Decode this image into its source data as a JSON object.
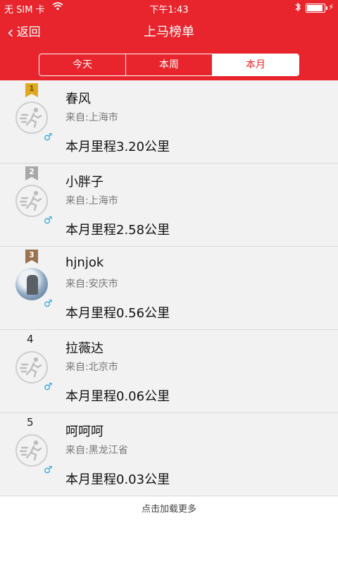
{
  "status": {
    "carrier": "无 SIM 卡",
    "time": "下午1:43"
  },
  "nav": {
    "back_label": "返回",
    "title": "上马榜单"
  },
  "tabs": [
    {
      "label": "今天",
      "active": false
    },
    {
      "label": "本周",
      "active": false
    },
    {
      "label": "本月",
      "active": true
    }
  ],
  "rankings": [
    {
      "rank": "1",
      "name": "春风",
      "location": "来自:上海市",
      "distance": "本月里程3.20公里",
      "gender": "♂"
    },
    {
      "rank": "2",
      "name": "小胖子",
      "location": "来自:上海市",
      "distance": "本月里程2.58公里",
      "gender": "♂"
    },
    {
      "rank": "3",
      "name": "hjnjok",
      "location": "来自:安庆市",
      "distance": "本月里程0.56公里",
      "gender": "♂"
    },
    {
      "rank": "4",
      "name": "拉薇达",
      "location": "来自:北京市",
      "distance": "本月里程0.06公里",
      "gender": "♂"
    },
    {
      "rank": "5",
      "name": " 呵呵呵",
      "location": "来自:黑龙江省",
      "distance": "本月里程0.03公里",
      "gender": "♂"
    }
  ],
  "load_more": "点击加载更多"
}
